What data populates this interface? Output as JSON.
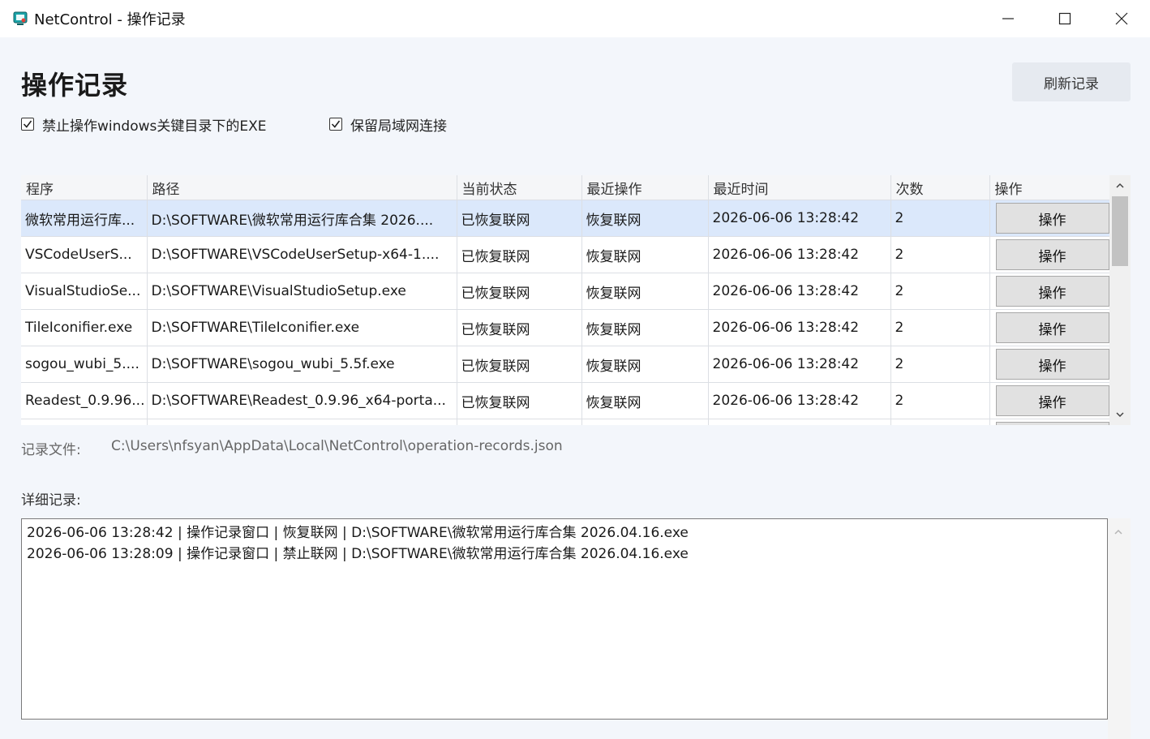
{
  "window": {
    "title": "NetControl - 操作记录",
    "accent": "#1aa3a8"
  },
  "header": {
    "title": "操作记录",
    "refresh_label": "刷新记录"
  },
  "options": {
    "block_exe_label": "禁止操作windows关键目录下的EXE",
    "block_exe_checked": true,
    "keep_lan_label": "保留局域网连接",
    "keep_lan_checked": true
  },
  "table": {
    "columns": [
      "程序",
      "路径",
      "当前状态",
      "最近操作",
      "最近时间",
      "次数",
      "操作"
    ],
    "rows": [
      {
        "program": "微软常用运行库...",
        "path": "D:\\SOFTWARE\\微软常用运行库合集 2026....",
        "status": "已恢复联网",
        "last_action": "恢复联网",
        "last_time": "2026-06-06 13:28:42",
        "count": "2",
        "action": "操作",
        "selected": true
      },
      {
        "program": "VSCodeUserS...",
        "path": "D:\\SOFTWARE\\VSCodeUserSetup-x64-1....",
        "status": "已恢复联网",
        "last_action": "恢复联网",
        "last_time": "2026-06-06 13:28:42",
        "count": "2",
        "action": "操作"
      },
      {
        "program": "VisualStudioSe...",
        "path": "D:\\SOFTWARE\\VisualStudioSetup.exe",
        "status": "已恢复联网",
        "last_action": "恢复联网",
        "last_time": "2026-06-06 13:28:42",
        "count": "2",
        "action": "操作"
      },
      {
        "program": "TileIconifier.exe",
        "path": "D:\\SOFTWARE\\TileIconifier.exe",
        "status": "已恢复联网",
        "last_action": "恢复联网",
        "last_time": "2026-06-06 13:28:42",
        "count": "2",
        "action": "操作"
      },
      {
        "program": "sogou_wubi_5....",
        "path": "D:\\SOFTWARE\\sogou_wubi_5.5f.exe",
        "status": "已恢复联网",
        "last_action": "恢复联网",
        "last_time": "2026-06-06 13:28:42",
        "count": "2",
        "action": "操作"
      },
      {
        "program": "Readest_0.9.96...",
        "path": "D:\\SOFTWARE\\Readest_0.9.96_x64-porta...",
        "status": "已恢复联网",
        "last_action": "恢复联网",
        "last_time": "2026-06-06 13:28:42",
        "count": "2",
        "action": "操作"
      },
      {
        "program": "",
        "path": "",
        "status": "",
        "last_action": "",
        "last_time": "",
        "count": "",
        "action": ""
      }
    ]
  },
  "records": {
    "file_label": "记录文件:",
    "file_path": "C:\\Users\\nfsyan\\AppData\\Local\\NetControl\\operation-records.json",
    "detail_label": "详细记录:",
    "log_lines": [
      "2026-06-06 13:28:42 | 操作记录窗口 | 恢复联网 | D:\\SOFTWARE\\微软常用运行库合集 2026.04.16.exe",
      "2026-06-06 13:28:09 | 操作记录窗口 | 禁止联网 | D:\\SOFTWARE\\微软常用运行库合集 2026.04.16.exe"
    ]
  }
}
